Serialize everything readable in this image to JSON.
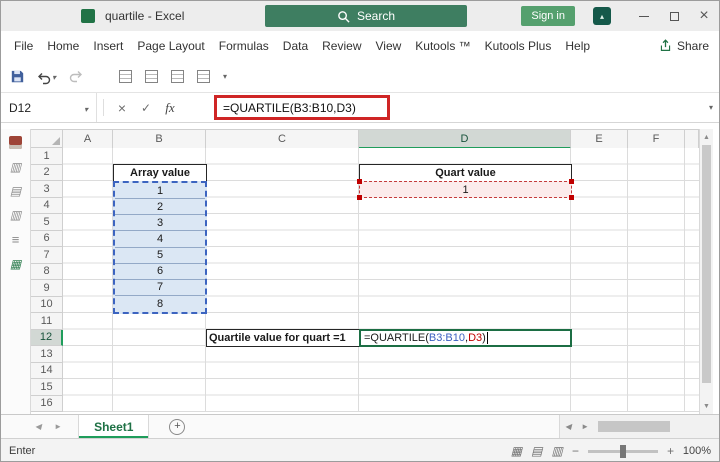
{
  "titlebar": {
    "title": "quartile - Excel",
    "search_placeholder": "Search",
    "sign_in_label": "Sign in"
  },
  "menubar": {
    "tabs": [
      "File",
      "Home",
      "Insert",
      "Page Layout",
      "Formulas",
      "Data",
      "Review",
      "View",
      "Kutools ™",
      "Kutools Plus",
      "Help"
    ],
    "share_label": "Share"
  },
  "formula_bar": {
    "name_box_value": "D12",
    "formula": "=QUARTILE(B3:B10,D3)"
  },
  "grid": {
    "column_headers": [
      "A",
      "B",
      "C",
      "D",
      "E",
      "F"
    ],
    "row_headers": [
      "1",
      "2",
      "3",
      "4",
      "5",
      "6",
      "7",
      "8",
      "9",
      "10",
      "11",
      "12",
      "13",
      "14",
      "15",
      "16"
    ],
    "array_table": {
      "header": "Array value",
      "values": [
        "1",
        "2",
        "3",
        "4",
        "5",
        "6",
        "7",
        "8"
      ]
    },
    "quart_table": {
      "header": "Quart value",
      "value": "1"
    },
    "c12_label": "Quartile value for quart =1",
    "d12_formula": {
      "part1": "=QUARTILE(",
      "part2": "B3:B10",
      "part3": ",",
      "part4": "D3",
      "part5": ")"
    }
  },
  "sheet_tabs": {
    "active_tab": "Sheet1"
  },
  "status_bar": {
    "mode": "Enter",
    "zoom_level": "100%"
  },
  "colors": {
    "excel_green": "#217346",
    "title_search_green": "#3e7e61",
    "sign_in_green": "#55a06e",
    "reference_blue": "#3b5fc0",
    "reference_red": "#c00000",
    "blue_range_fill": "#dbe7f4",
    "red_cell_fill": "#fcecec",
    "formula_box_red": "#cf2525"
  }
}
